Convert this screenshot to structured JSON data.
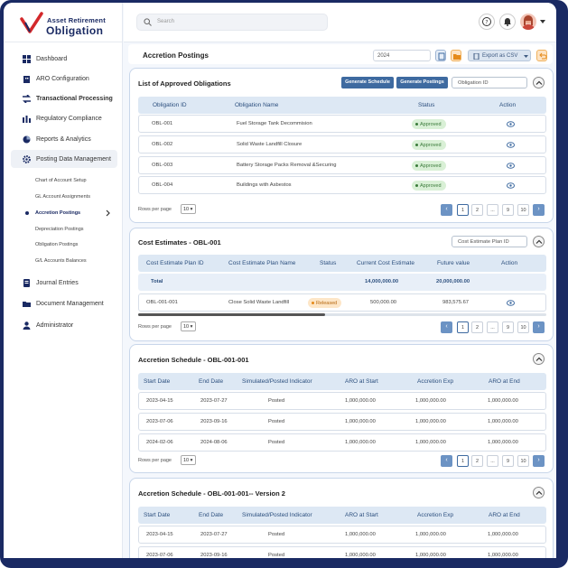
{
  "brand": {
    "line1": "Asset Retirement",
    "line2": "Obligation"
  },
  "search": {
    "placeholder": "Search"
  },
  "sidebar": {
    "items": [
      {
        "label": "Dashboard",
        "icon": "dashboard-icon"
      },
      {
        "label": "ARO Configuration",
        "icon": "building-icon"
      },
      {
        "label": "Transactional Processing",
        "icon": "transaction-icon"
      },
      {
        "label": "Regulatory Compliance",
        "icon": "compliance-icon"
      },
      {
        "label": "Reports & Analytics",
        "icon": "chart-icon"
      },
      {
        "label": "Posting Data Management",
        "icon": "gear-icon"
      },
      {
        "label": "Journal Entries",
        "icon": "journal-icon"
      },
      {
        "label": "Document Management",
        "icon": "folder-icon"
      },
      {
        "label": "Administrator",
        "icon": "user-icon"
      }
    ],
    "subitems": [
      "Chart of Account Setup",
      "GL Account Assignments",
      "Accretion Postings",
      "Depreciation Postings",
      "Obligation Postings",
      "G/L Accounts Balances"
    ]
  },
  "header": {
    "title": "Accretion Postings",
    "year": "2024",
    "export_label": "Export as CSV"
  },
  "obligations": {
    "title": "List of Approved Obligations",
    "generate_schedule": "Generate Schedule",
    "generate_postings": "Generate Postings",
    "filter_placeholder": "Obligation ID",
    "columns": [
      "Obligation ID",
      "Obligation Name",
      "Status",
      "Action"
    ],
    "rows": [
      {
        "id": "OBL-001",
        "name": "Fuel Storage Tank Decommision",
        "status": "Approved"
      },
      {
        "id": "OBL-002",
        "name": "Solid Waste Landfill Closure",
        "status": "Approved"
      },
      {
        "id": "OBL-003",
        "name": "Battery Storage Packs Removal &Securing",
        "status": "Approved"
      },
      {
        "id": "OBL-004",
        "name": "Buildings with Asbestos",
        "status": "Approved"
      }
    ],
    "rows_per_page_label": "Rows per page",
    "rows_per_page": "10",
    "pages": [
      "1",
      "2",
      "...",
      "9",
      "10"
    ]
  },
  "estimates": {
    "title": "Cost Estimates - OBL-001",
    "filter_placeholder": "Cost Estimate Plan ID",
    "columns": [
      "Cost Estimate Plan ID",
      "Cost Estimate Plan Name",
      "Status",
      "Current Cost Estimate",
      "Future value",
      "Action"
    ],
    "total": {
      "label": "Total",
      "current": "14,000,000.00",
      "future": "20,000,000.00"
    },
    "rows": [
      {
        "id": "OBL-001-001",
        "name": "Close Solid Waste Landfill",
        "status": "Released",
        "current": "500,000.00",
        "future": "983,575.67"
      }
    ],
    "rows_per_page_label": "Rows per page",
    "rows_per_page": "10",
    "pages": [
      "1",
      "2",
      "...",
      "9",
      "10"
    ]
  },
  "schedule1": {
    "title": "Accretion Schedule - OBL-001-001",
    "columns": [
      "Start Date",
      "End Date",
      "Simulated/Posted Indicator",
      "ARO at Start",
      "Accretion Exp",
      "ARO at End"
    ],
    "rows": [
      {
        "start": "2023-04-15",
        "end": "2023-07-27",
        "ind": "Posted",
        "aro_start": "1,000,000.00",
        "acc": "1,000,000.00",
        "aro_end": "1,000,000.00"
      },
      {
        "start": "2023-07-06",
        "end": "2023-09-16",
        "ind": "Posted",
        "aro_start": "1,000,000.00",
        "acc": "1,000,000.00",
        "aro_end": "1,000,000.00"
      },
      {
        "start": "2024-02-06",
        "end": "2024-08-06",
        "ind": "Posted",
        "aro_start": "1,000,000.00",
        "acc": "1,000,000.00",
        "aro_end": "1,000,000.00"
      }
    ],
    "rows_per_page_label": "Rows per page",
    "rows_per_page": "10",
    "pages": [
      "1",
      "2",
      "...",
      "9",
      "10"
    ]
  },
  "schedule2": {
    "title": "Accretion Schedule - OBL-001-001-- Version 2",
    "columns": [
      "Start Date",
      "End Date",
      "Simulated/Posted Indicator",
      "ARO at Start",
      "Accretion Exp",
      "ARO at End"
    ],
    "rows": [
      {
        "start": "2023-04-15",
        "end": "2023-07-27",
        "ind": "Posted",
        "aro_start": "1,000,000.00",
        "acc": "1,000,000.00",
        "aro_end": "1,000,000.00"
      },
      {
        "start": "2023-07-06",
        "end": "2023-09-16",
        "ind": "Posted",
        "aro_start": "1,000,000.00",
        "acc": "1,000,000.00",
        "aro_end": "1,000,000.00"
      }
    ]
  }
}
